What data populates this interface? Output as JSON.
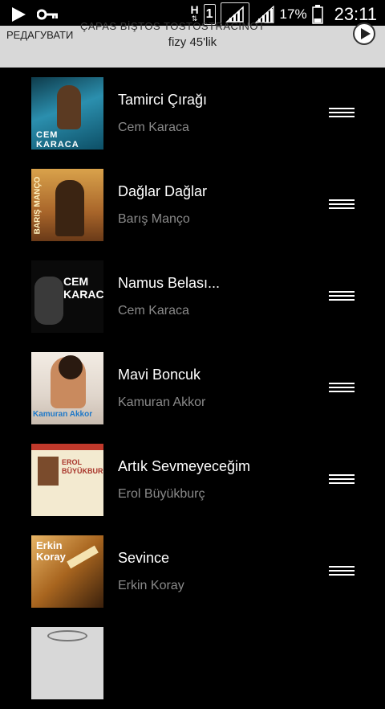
{
  "status_bar": {
    "signal_label": "H",
    "sim_slot": "1",
    "battery": "17%",
    "time": "23:11",
    "icons": [
      "play-icon",
      "key-icon",
      "data-h-icon",
      "sim-1-icon",
      "signal-icon",
      "signal-icon",
      "battery-icon"
    ]
  },
  "header": {
    "edit_label": "РЕДАГУВАТИ",
    "overline": "ÇAPAS BİŞTOS TOSTOSTRACINOT",
    "playlist_title": "fizy 45'lik",
    "play_icon": "play-circle-icon"
  },
  "tracks": [
    {
      "title": "Tamirci Çırağı",
      "artist": "Cem Karaca",
      "cover_text": "CEM KARACA",
      "cover_color": "#1f6f8c"
    },
    {
      "title": "Dağlar Dağlar",
      "artist": "Barış Manço",
      "cover_text": "BARIŞ MANÇO",
      "cover_color": "#b27a2a"
    },
    {
      "title": "Namus Belası...",
      "artist": "Cem Karaca",
      "cover_text": "CEM KARACA",
      "cover_color": "#111111"
    },
    {
      "title": "Mavi Boncuk",
      "artist": "Kamuran Akkor",
      "cover_text": "Kamuran Akkor",
      "cover_color": "#e8e2dc"
    },
    {
      "title": "Artık Sevmeyeceğim",
      "artist": "Erol Büyükburç",
      "cover_text": "EROL BÜYÜKBURÇ",
      "cover_color": "#f1e7c7"
    },
    {
      "title": "Sevince",
      "artist": "Erkin Koray",
      "cover_text": "Erkin Koray",
      "cover_color": "#7a4a1a"
    }
  ]
}
